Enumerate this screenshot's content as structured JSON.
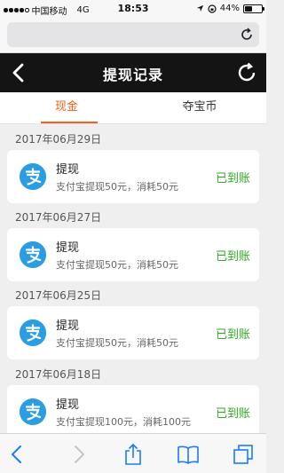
{
  "status_bar": {
    "carrier": "中国移动",
    "network": "4G",
    "time": "18:53",
    "battery_percent": "44%",
    "battery_level": 0.44
  },
  "browser": {
    "url": ""
  },
  "nav": {
    "title": "提现记录"
  },
  "tabs": [
    {
      "label": "现金",
      "active": true
    },
    {
      "label": "夺宝币",
      "active": false
    }
  ],
  "records": [
    {
      "date": "2017年06月29日",
      "title": "提现",
      "detail": "支付宝提现50元，消耗50元",
      "status": "已到账"
    },
    {
      "date": "2017年06月27日",
      "title": "提现",
      "detail": "支付宝提现50元，消耗50元",
      "status": "已到账"
    },
    {
      "date": "2017年06月25日",
      "title": "提现",
      "detail": "支付宝提现50元，消耗50元",
      "status": "已到账"
    },
    {
      "date": "2017年06月18日",
      "title": "提现",
      "detail": "支付宝提现100元，消耗100元",
      "status": "已到账"
    }
  ],
  "colors": {
    "accent": "#f3601b",
    "success": "#2ea91f",
    "alipay": "#2a9de3",
    "nav_bg": "#141414"
  },
  "icons": [
    "back-icon",
    "refresh-icon",
    "alipay-icon",
    "share-icon",
    "bookmarks-icon",
    "tabs-icon"
  ]
}
